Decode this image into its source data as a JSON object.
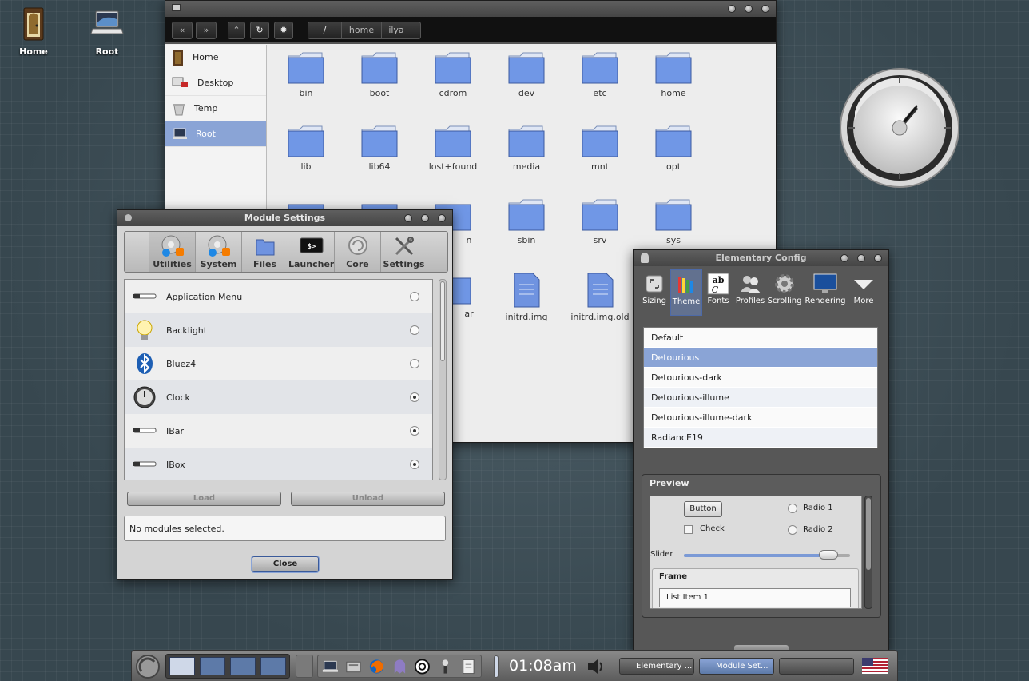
{
  "desktop": {
    "icons": [
      {
        "label": "Home"
      },
      {
        "label": "Root"
      }
    ]
  },
  "file_manager": {
    "path": [
      "/",
      "home",
      "ilya"
    ],
    "sidebar": [
      {
        "label": "Home"
      },
      {
        "label": "Desktop"
      },
      {
        "label": "Temp"
      },
      {
        "label": "Root"
      }
    ],
    "files": [
      {
        "name": "bin"
      },
      {
        "name": "boot"
      },
      {
        "name": "cdrom"
      },
      {
        "name": "dev"
      },
      {
        "name": "etc"
      },
      {
        "name": "home"
      },
      {
        "name": "lib"
      },
      {
        "name": "lib64"
      },
      {
        "name": "lost+found"
      },
      {
        "name": "media"
      },
      {
        "name": "mnt"
      },
      {
        "name": "opt"
      },
      {
        "name": "sbin"
      },
      {
        "name": "srv"
      },
      {
        "name": "sys"
      },
      {
        "name": "initrd.img"
      },
      {
        "name": "initrd.img.old"
      }
    ],
    "partial_labels": [
      "n",
      "ar"
    ]
  },
  "module_settings": {
    "title": "Module Settings",
    "tabs": [
      {
        "label": "Utilities"
      },
      {
        "label": "System"
      },
      {
        "label": "Files"
      },
      {
        "label": "Launcher"
      },
      {
        "label": "Core"
      },
      {
        "label": "Settings"
      }
    ],
    "launcher_glyph": "$>",
    "modules": [
      {
        "name": "Application Menu",
        "loaded": false
      },
      {
        "name": "Backlight",
        "loaded": false
      },
      {
        "name": "Bluez4",
        "loaded": false
      },
      {
        "name": "Clock",
        "loaded": true
      },
      {
        "name": "IBar",
        "loaded": true
      },
      {
        "name": "IBox",
        "loaded": true
      }
    ],
    "load_label": "Load",
    "unload_label": "Unload",
    "status": "No modules selected.",
    "close_label": "Close"
  },
  "elementary_config": {
    "title": "Elementary Config",
    "tabs": [
      {
        "label": "Sizing"
      },
      {
        "label": "Theme"
      },
      {
        "label": "Fonts"
      },
      {
        "label": "Profiles"
      },
      {
        "label": "Scrolling"
      },
      {
        "label": "Rendering"
      },
      {
        "label": "More"
      }
    ],
    "fonts_glyph_top": "ab",
    "fonts_glyph_bottom": "C",
    "themes": [
      {
        "name": "Default"
      },
      {
        "name": "Detourious"
      },
      {
        "name": "Detourious-dark"
      },
      {
        "name": "Detourious-illume"
      },
      {
        "name": "Detourious-illume-dark"
      },
      {
        "name": "RadiancE19"
      }
    ],
    "selected_theme": "Detourious",
    "preview": {
      "title": "Preview",
      "button_label": "Button",
      "radio1": "Radio 1",
      "radio2": "Radio 2",
      "check": "Check",
      "slider_label": "Slider",
      "slider_value": 0.87,
      "frame_title": "Frame",
      "list_item": "List Item 1"
    }
  },
  "shelf": {
    "time": "01:08am",
    "tasks": [
      {
        "label": "Elementary ..."
      },
      {
        "label": "Module Set..."
      }
    ]
  }
}
